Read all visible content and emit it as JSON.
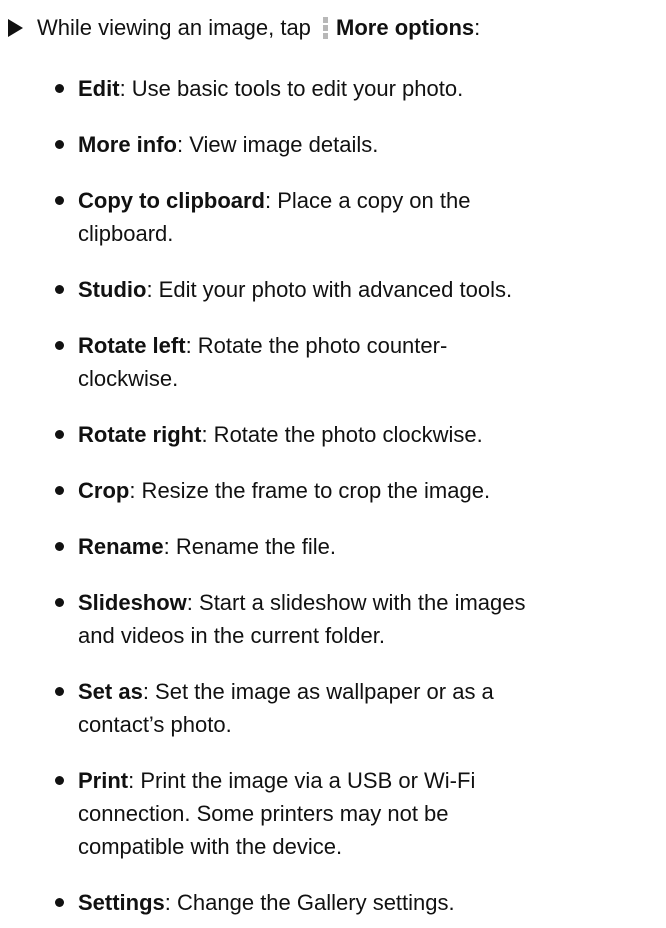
{
  "intro": {
    "prefix": "While viewing an image, tap",
    "icon": "more-options-vertical-dots-icon",
    "bold": "More options",
    "suffix": ":"
  },
  "items": [
    {
      "term": "Edit",
      "desc": ": Use basic tools to edit your photo."
    },
    {
      "term": "More info",
      "desc": ": View image details."
    },
    {
      "term": "Copy to clipboard",
      "desc": ": Place a copy on the"
    },
    {
      "term": "",
      "desc": "clipboard."
    },
    {
      "term": "Studio",
      "desc": ": Edit your photo with advanced tools."
    },
    {
      "term": "Rotate left",
      "desc": ": Rotate the photo counter-"
    },
    {
      "term": "",
      "desc": "clockwise."
    },
    {
      "term": "Rotate right",
      "desc": ": Rotate the photo clockwise."
    },
    {
      "term": "Crop",
      "desc": ": Resize the frame to crop the image."
    },
    {
      "term": "Rename",
      "desc": ": Rename the file."
    },
    {
      "term": "Slideshow",
      "desc": ": Start a slideshow with the images"
    },
    {
      "term": "",
      "desc": "and videos in the current folder."
    },
    {
      "term": "Set as",
      "desc": ": Set the image as wallpaper or as a"
    },
    {
      "term": "",
      "desc": "contact’s photo."
    },
    {
      "term": "Print",
      "desc": ": Print the image via a USB or Wi-Fi"
    },
    {
      "term": "",
      "desc": "connection. Some printers may not be"
    },
    {
      "term": "",
      "desc": "compatible with the device."
    },
    {
      "term": "Settings",
      "desc": ": Change the Gallery settings."
    }
  ]
}
